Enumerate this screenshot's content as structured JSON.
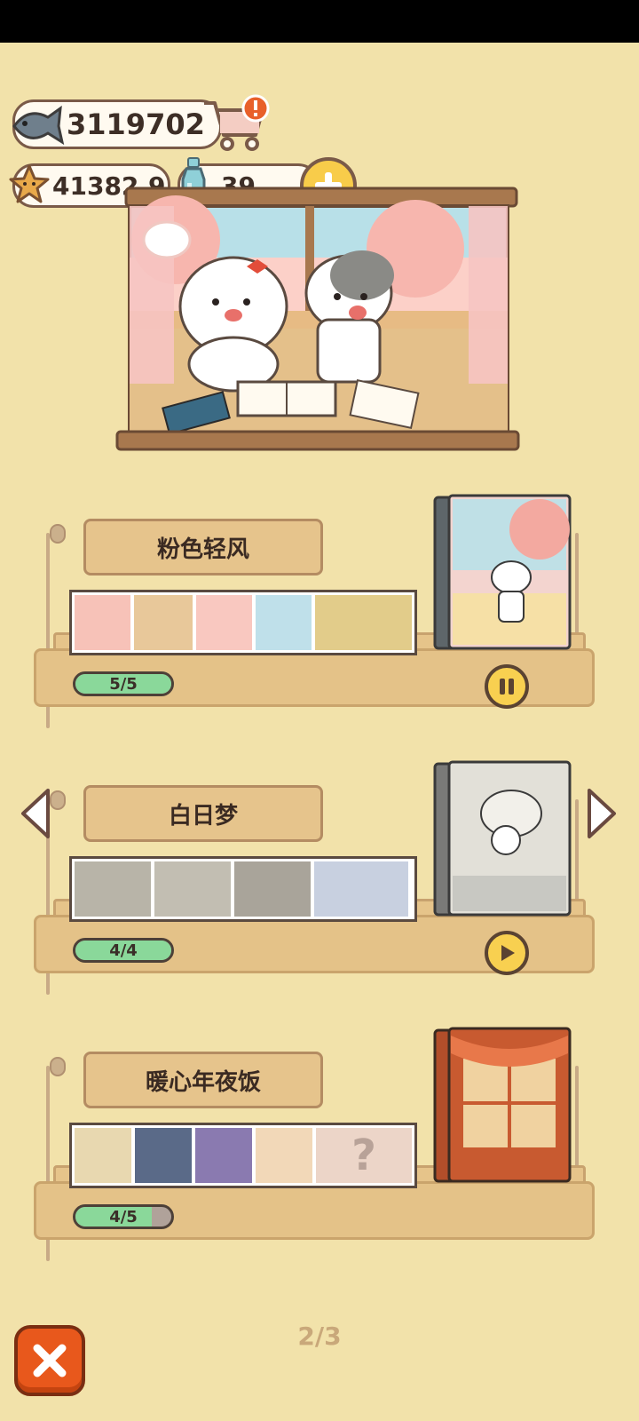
{
  "currency": {
    "fish": "3119702",
    "stars": "41382.9",
    "bottles": "39"
  },
  "albums": [
    {
      "title": "粉色轻风",
      "progress": "5/5",
      "fraction": 1.0,
      "state": "pause"
    },
    {
      "title": "白日梦",
      "progress": "4/4",
      "fraction": 1.0,
      "state": "play"
    },
    {
      "title": "暖心年夜饭",
      "progress": "4/5",
      "fraction": 0.8,
      "state": "none"
    }
  ],
  "locked_mark": "?",
  "pagination": {
    "label": "2/3"
  },
  "colors": {
    "accent": "#f8d050",
    "progress_fill": "#8ad89a",
    "close": "#e8581c"
  }
}
